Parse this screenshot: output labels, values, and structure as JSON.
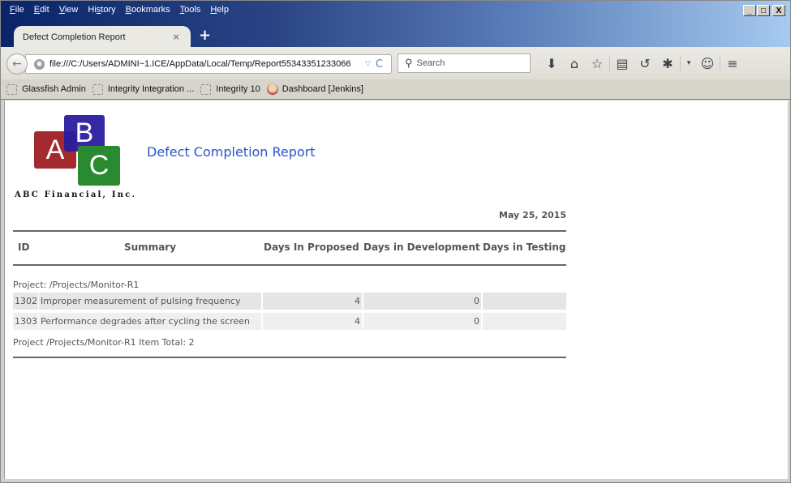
{
  "menu": [
    "File",
    "Edit",
    "View",
    "History",
    "Bookmarks",
    "Tools",
    "Help"
  ],
  "menu_accel": [
    "F",
    "E",
    "V",
    "s",
    "B",
    "T",
    "H"
  ],
  "window_controls": {
    "minimize": "_",
    "maximize": "□",
    "close": "X"
  },
  "tab": {
    "title": "Defect Completion Report",
    "close": "×",
    "new_tab": "+"
  },
  "navbar": {
    "back_icon": "←",
    "url": "file:///C:/Users/ADMINI~1.ICE/AppData/Local/Temp/Report55343351233066",
    "dropdown_icon": "▽",
    "reload_icon": "C",
    "search_placeholder": "Search",
    "toolbar_icons": [
      "download-icon",
      "home-icon",
      "bookmark-star-icon",
      "reading-list-icon",
      "history-icon",
      "firebug-icon",
      "dropdown-icon",
      "chat-icon",
      "menu-icon"
    ],
    "toolbar_glyphs": {
      "download": "⬇",
      "home": "⌂",
      "star": "☆",
      "reading": "▤",
      "history": "↺",
      "bug": "✱",
      "dropdown": "▾",
      "chat": "☺",
      "menu": "≡"
    }
  },
  "bookmarks": [
    {
      "label": "Glassfish Admin"
    },
    {
      "label": "Integrity Integration ..."
    },
    {
      "label": "Integrity 10"
    },
    {
      "label": "Dashboard [Jenkins]"
    }
  ],
  "report": {
    "logo_letters": [
      "A",
      "B",
      "C"
    ],
    "company": "ABC Financial, Inc.",
    "title": "Defect Completion Report",
    "date": "May 25, 2015",
    "colors": {
      "title": "#2a55c9",
      "logo_a": "#a32a2e",
      "logo_b": "#281ca0",
      "logo_c": "#2a8a2f"
    },
    "columns": [
      "ID",
      "Summary",
      "Days In Proposed",
      "Days in Development",
      "Days in Testing"
    ],
    "project_header": "Project: /Projects/Monitor-R1",
    "rows": [
      {
        "id": "1302",
        "summary": "Improper measurement of pulsing frequency",
        "days_proposed": "4",
        "days_development": "0",
        "days_testing": ""
      },
      {
        "id": "1303",
        "summary": "Performance degrades after cycling the screen",
        "days_proposed": "4",
        "days_development": "0",
        "days_testing": ""
      }
    ],
    "project_footer": "Project /Projects/Monitor-R1 Item Total: 2"
  }
}
